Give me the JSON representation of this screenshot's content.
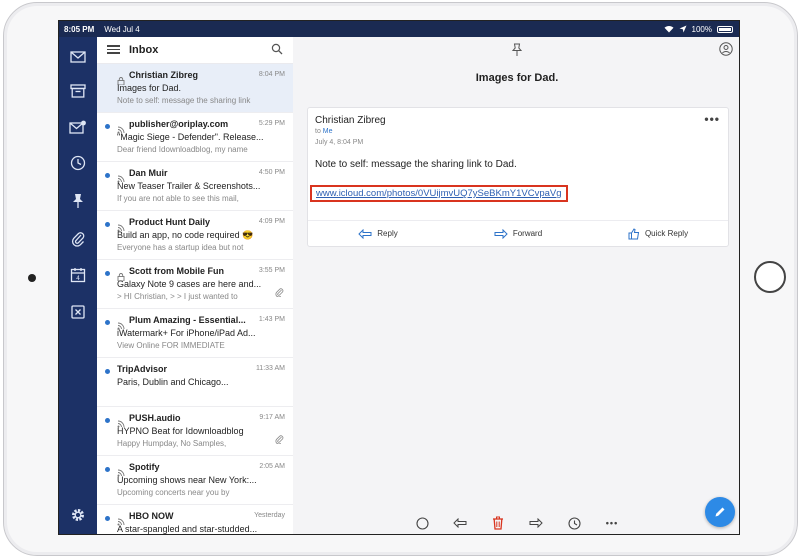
{
  "status_bar": {
    "time": "8:05 PM",
    "date": "Wed Jul 4",
    "battery": "100%"
  },
  "list": {
    "title": "Inbox",
    "items": [
      {
        "sender": "Christian Zibreg",
        "time": "8:04 PM",
        "subject": "Images for Dad.",
        "preview": "Note to self: message the sharing link",
        "icon": "lock-icon"
      },
      {
        "sender": "publisher@oriplay.com",
        "time": "5:29 PM",
        "subject": "\"Magic Siege - Defender\". Release...",
        "preview": "Dear friend Idownloadblog, my name",
        "icon": "rss-icon"
      },
      {
        "sender": "Dan Muir",
        "time": "4:50 PM",
        "subject": "New Teaser Trailer & Screenshots...",
        "preview": "If you are not able to see this mail,",
        "icon": "rss-icon"
      },
      {
        "sender": "Product Hunt Daily",
        "time": "4:09 PM",
        "subject": "Build an app, no code required 😎",
        "preview": "Everyone has a startup idea but not",
        "icon": "rss-icon"
      },
      {
        "sender": "Scott from Mobile Fun",
        "time": "3:55 PM",
        "subject": "Galaxy Note 9 cases are here and...",
        "preview": "> HI Christian, > > I just wanted to",
        "icon": "lock-icon"
      },
      {
        "sender": "Plum Amazing - Essential...",
        "time": "1:43 PM",
        "subject": "iWatermark+ For iPhone/iPad Ad...",
        "preview": "View Online FOR IMMEDIATE",
        "icon": "rss-icon"
      },
      {
        "sender": "TripAdvisor",
        "time": "11:33 AM",
        "subject": "Paris, Dublin and Chicago...",
        "preview": "",
        "icon": ""
      },
      {
        "sender": "PUSH.audio",
        "time": "9:17 AM",
        "subject": "HYPNO Beat for Idownloadblog",
        "preview": "Happy Humpday, No Samples,",
        "icon": "rss-icon"
      },
      {
        "sender": "Spotify",
        "time": "2:05 AM",
        "subject": "Upcoming shows near New York:...",
        "preview": "Upcoming concerts near you by",
        "icon": "rss-icon"
      },
      {
        "sender": "HBO NOW",
        "time": "Yesterday",
        "subject": "A star-spangled and star-studded...",
        "preview": "",
        "icon": "rss-icon"
      }
    ]
  },
  "detail": {
    "title": "Images for Dad.",
    "from": "Christian Zibreg",
    "to_label": "to",
    "to": "Me",
    "date": "July 4, 8:04 PM",
    "more": "•••",
    "body": "Note to self: message the sharing link to Dad.",
    "link": "www.icloud.com/photos/0VUijmvUQ7ySeBKmY1VCvpaVg",
    "actions": {
      "reply": "Reply",
      "forward": "Forward",
      "quick_reply": "Quick Reply"
    }
  },
  "toolbar_more": "•••",
  "colors": {
    "sidebar": "#1c3166",
    "accent": "#2d73c9",
    "link_highlight": "#d9341f",
    "fab": "#2d8ae6"
  }
}
